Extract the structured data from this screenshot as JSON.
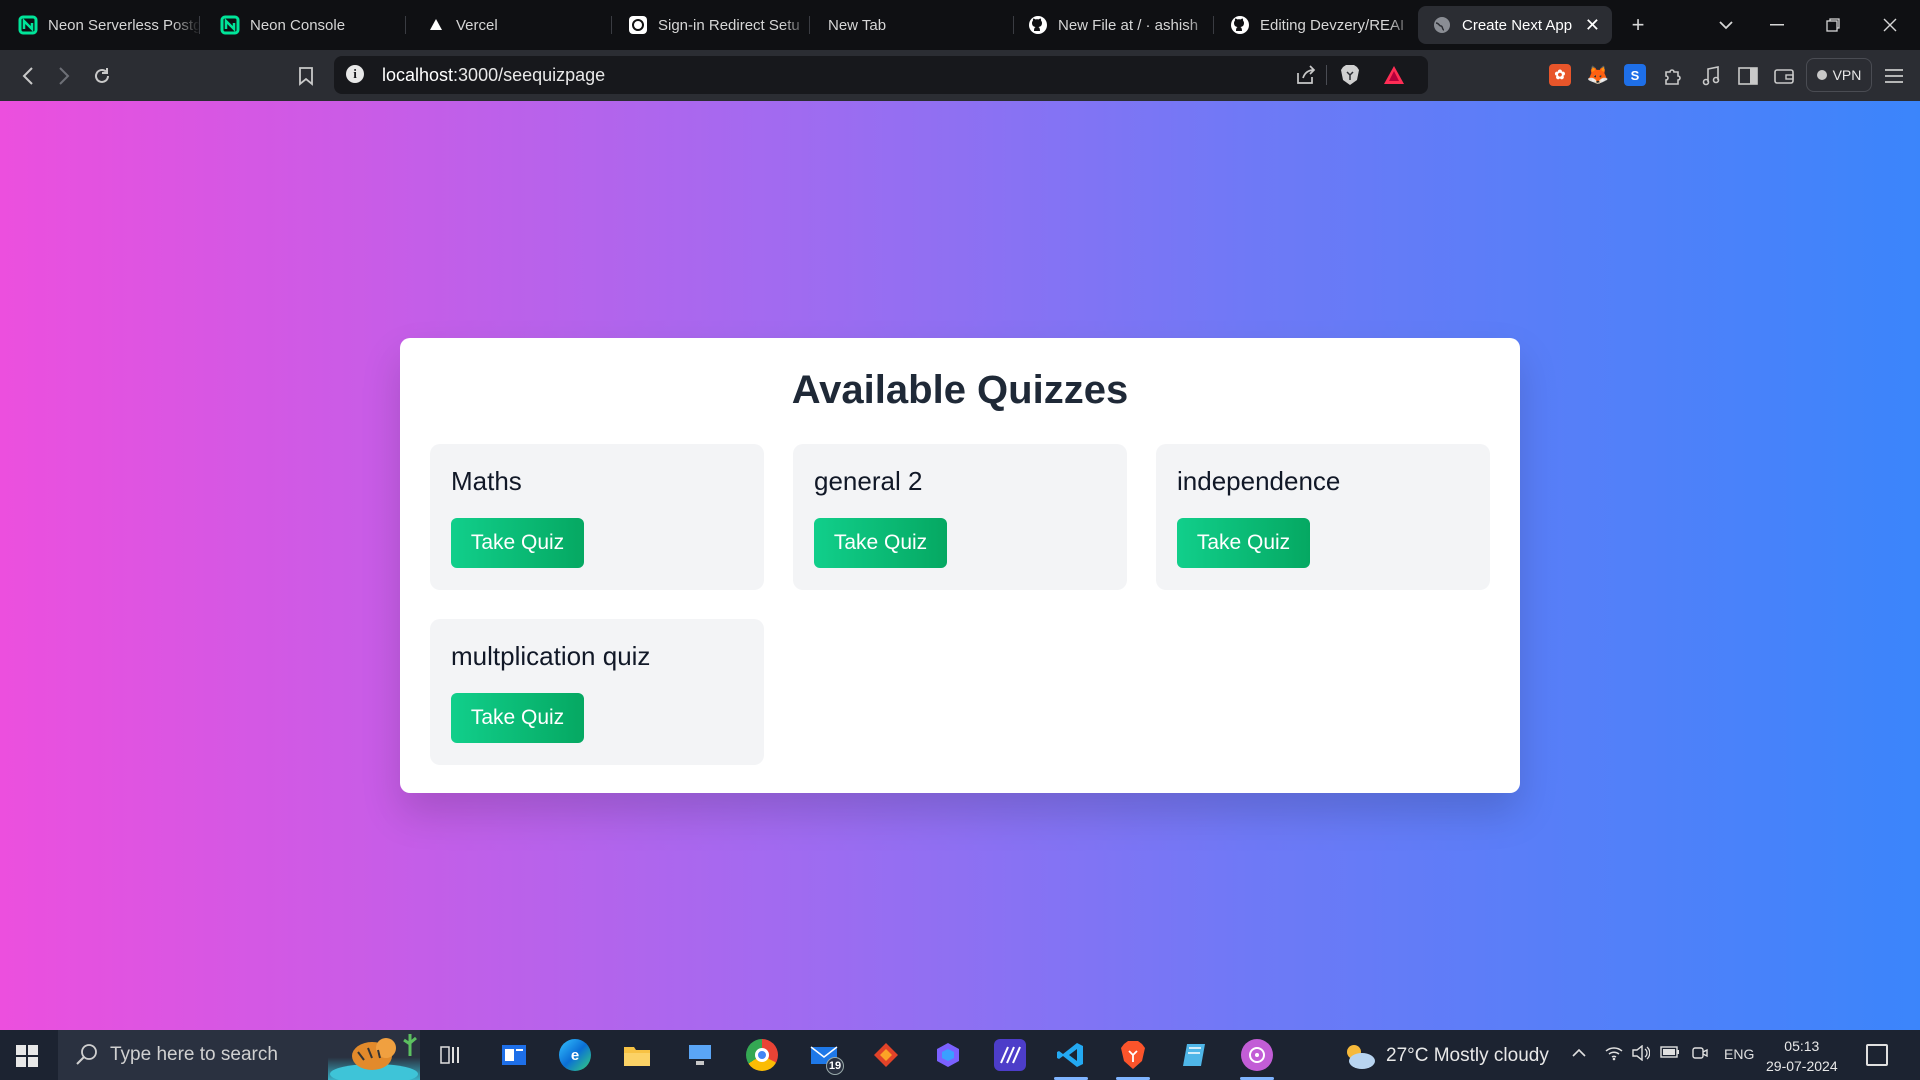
{
  "tabs": [
    {
      "title": "Neon Serverless Postg",
      "icon": "neon-logo-icon"
    },
    {
      "title": "Neon Console",
      "icon": "neon-logo-icon"
    },
    {
      "title": "Vercel",
      "icon": "vercel-triangle-icon"
    },
    {
      "title": "Sign-in Redirect Setu",
      "icon": "openai-logo-icon"
    },
    {
      "title": "New Tab",
      "icon": ""
    },
    {
      "title": "New File at / · ashish",
      "icon": "github-logo-icon"
    },
    {
      "title": "Editing Devzery/REAI",
      "icon": "github-logo-icon"
    },
    {
      "title": "Create Next App",
      "icon": "globe-icon",
      "active": true
    }
  ],
  "address": {
    "host": "localhost",
    "path": ":3000/seequizpage"
  },
  "toolbar": {
    "vpn_label": "VPN"
  },
  "page": {
    "title": "Available Quizzes",
    "quizzes": [
      {
        "name": "Maths",
        "button": "Take Quiz"
      },
      {
        "name": "general 2",
        "button": "Take Quiz"
      },
      {
        "name": "independence",
        "button": "Take Quiz"
      },
      {
        "name": "multplication quiz",
        "button": "Take Quiz"
      }
    ]
  },
  "taskbar": {
    "search_placeholder": "Type here to search",
    "mail_badge": "19",
    "weather": "27°C  Mostly cloudy",
    "language": "ENG",
    "time": "05:13",
    "date": "29-07-2024"
  },
  "colors": {
    "gradient_start": "#ec4fde",
    "gradient_end": "#3b85fb",
    "button_green": "#10c784",
    "title_text": "#1f2937"
  }
}
